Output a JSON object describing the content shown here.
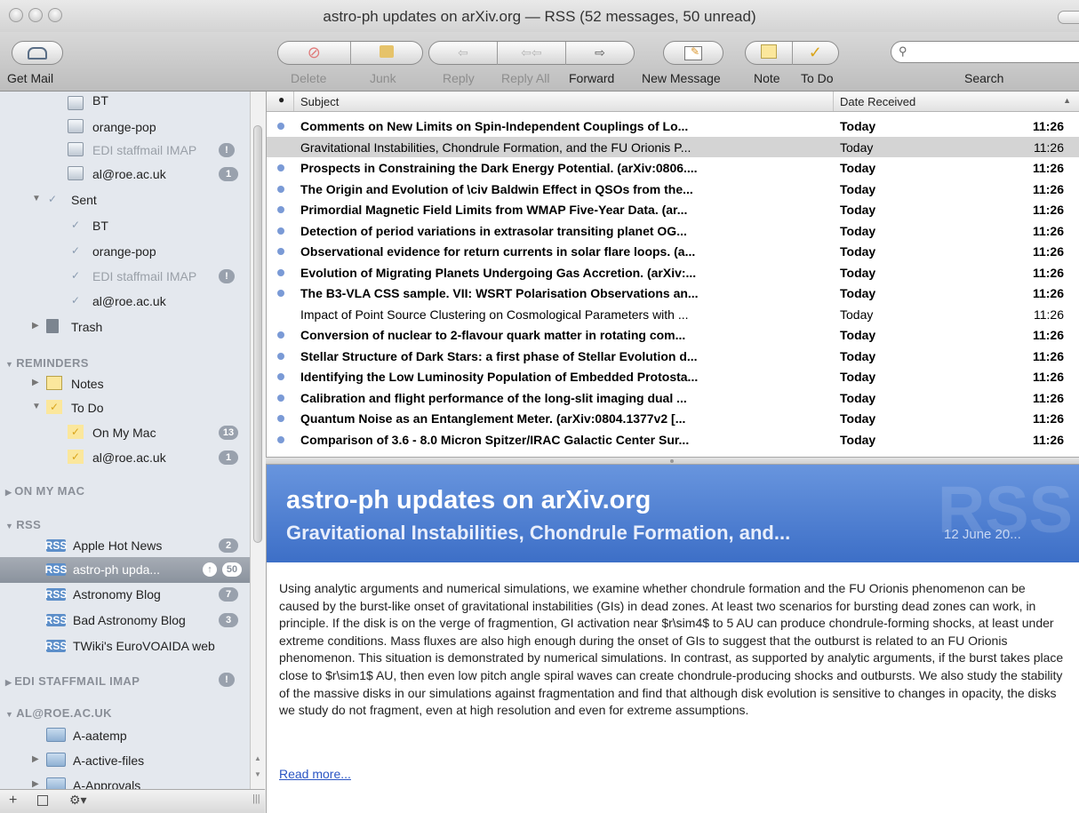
{
  "window": {
    "title": "astro-ph updates on arXiv.org — RSS (52 messages, 50 unread)"
  },
  "toolbar": {
    "get_mail": "Get Mail",
    "delete": "Delete",
    "junk": "Junk",
    "reply": "Reply",
    "reply_all": "Reply All",
    "forward": "Forward",
    "new_message": "New Message",
    "note": "Note",
    "todo": "To Do",
    "search": "Search",
    "search_placeholder": ""
  },
  "sidebar": {
    "inbox_children": [
      {
        "label": "BT",
        "badge": ""
      },
      {
        "label": "orange-pop",
        "badge": ""
      },
      {
        "label": "EDI staffmail IMAP",
        "badge": "!"
      },
      {
        "label": "al@roe.ac.uk",
        "badge": "1"
      }
    ],
    "sent": "Sent",
    "sent_children": [
      {
        "label": "BT",
        "badge": ""
      },
      {
        "label": "orange-pop",
        "badge": ""
      },
      {
        "label": "EDI staffmail IMAP",
        "badge": "!"
      },
      {
        "label": "al@roe.ac.uk",
        "badge": ""
      }
    ],
    "trash": "Trash",
    "reminders_header": "REMINDERS",
    "notes": "Notes",
    "todo": "To Do",
    "todo_children": [
      {
        "label": "On My Mac",
        "badge": "13"
      },
      {
        "label": "al@roe.ac.uk",
        "badge": "1"
      }
    ],
    "on_my_mac_header": "ON MY MAC",
    "rss_header": "RSS",
    "rss_items": [
      {
        "label": "Apple Hot News",
        "badge": "2"
      },
      {
        "label": "astro-ph upda...",
        "badge": "50"
      },
      {
        "label": "Astronomy Blog",
        "badge": "7"
      },
      {
        "label": "Bad Astronomy Blog",
        "badge": "3"
      },
      {
        "label": "TWiki's EuroVOAIDA web",
        "badge": ""
      }
    ],
    "edi_header": "EDI STAFFMAIL IMAP",
    "edi_badge": "!",
    "al_header": "AL@ROE.AC.UK",
    "al_children": [
      {
        "label": "A-aatemp"
      },
      {
        "label": "A-active-files"
      },
      {
        "label": "A-Approvals"
      }
    ]
  },
  "list": {
    "col_subject": "Subject",
    "col_date": "Date Received",
    "messages": [
      {
        "subject": "Comments on New Limits on Spin-Independent Couplings of Lo...",
        "date": "Today",
        "time": "11:26",
        "unread": true
      },
      {
        "subject": "Gravitational Instabilities, Chondrule Formation, and the FU Orionis P...",
        "date": "Today",
        "time": "11:26",
        "unread": false
      },
      {
        "subject": "Prospects in Constraining the Dark Energy Potential. (arXiv:0806....",
        "date": "Today",
        "time": "11:26",
        "unread": true
      },
      {
        "subject": "The Origin and Evolution of \\civ Baldwin Effect in QSOs from the...",
        "date": "Today",
        "time": "11:26",
        "unread": true
      },
      {
        "subject": "Primordial Magnetic Field Limits from WMAP Five-Year Data. (ar...",
        "date": "Today",
        "time": "11:26",
        "unread": true
      },
      {
        "subject": "Detection of period variations in extrasolar transiting planet OG...",
        "date": "Today",
        "time": "11:26",
        "unread": true
      },
      {
        "subject": "Observational evidence for return currents in solar flare loops. (a...",
        "date": "Today",
        "time": "11:26",
        "unread": true
      },
      {
        "subject": "Evolution of Migrating Planets Undergoing Gas Accretion. (arXiv:...",
        "date": "Today",
        "time": "11:26",
        "unread": true
      },
      {
        "subject": "The B3-VLA CSS sample. VII: WSRT Polarisation Observations an...",
        "date": "Today",
        "time": "11:26",
        "unread": true
      },
      {
        "subject": "Impact of Point Source Clustering on Cosmological Parameters with ...",
        "date": "Today",
        "time": "11:26",
        "unread": false
      },
      {
        "subject": "Conversion of nuclear to 2-flavour quark matter in rotating com...",
        "date": "Today",
        "time": "11:26",
        "unread": true
      },
      {
        "subject": "Stellar Structure of Dark Stars: a first phase of Stellar Evolution d...",
        "date": "Today",
        "time": "11:26",
        "unread": true
      },
      {
        "subject": "Identifying the Low Luminosity Population of Embedded Protosta...",
        "date": "Today",
        "time": "11:26",
        "unread": true
      },
      {
        "subject": "Calibration and flight performance of the long-slit imaging dual ...",
        "date": "Today",
        "time": "11:26",
        "unread": true
      },
      {
        "subject": "Quantum Noise as an Entanglement Meter. (arXiv:0804.1377v2 [...",
        "date": "Today",
        "time": "11:26",
        "unread": true
      },
      {
        "subject": "Comparison of 3.6 - 8.0 Micron Spitzer/IRAC Galactic Center Sur...",
        "date": "Today",
        "time": "11:26",
        "unread": true
      }
    ]
  },
  "preview": {
    "feed_title": "astro-ph updates on arXiv.org",
    "article_title": "Gravitational Instabilities, Chondrule Formation, and...",
    "date": "12 June 20...",
    "watermark": "RSS",
    "body": "Using analytic arguments and numerical simulations, we examine whether chondrule formation and the FU Orionis phenomenon can be caused by the burst-like onset of gravitational instabilities (GIs) in dead zones. At least two scenarios for bursting dead zones can work, in principle. If the disk is on the verge of fragmention, GI activation near $r\\sim4$ to 5 AU can produce chondrule-forming shocks, at least under extreme conditions. Mass fluxes are also high enough during the onset of GIs to suggest that the outburst is related to an FU Orionis phenomenon. This situation is demonstrated by numerical simulations. In contrast, as supported by analytic arguments, if the burst takes place close to $r\\sim1$ AU, then even low pitch angle spiral waves can create chondrule-producing shocks and outbursts. We also study the stability of the massive disks in our simulations against fragmentation and find that although disk evolution is sensitive to changes in opacity, the disks we study do not fragment, even at high resolution and even for extreme assumptions.",
    "read_more": "Read more..."
  }
}
